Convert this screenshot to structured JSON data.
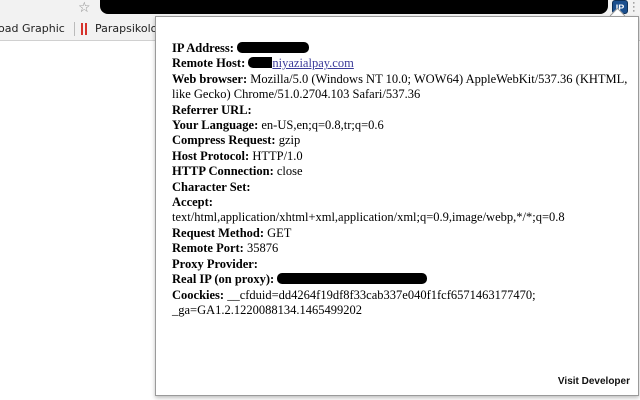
{
  "bookmarks": [
    "oad Graphic G",
    "Parapsikoloji,"
  ],
  "extension": {
    "badge": "IP"
  },
  "fields": [
    {
      "label": "IP Address:",
      "value": ""
    },
    {
      "label": "Remote Host:",
      "value": "niyazialpay.com"
    },
    {
      "label": "Web browser:",
      "value": "Mozilla/5.0 (Windows NT 10.0; WOW64) AppleWebKit/537.36 (KHTML, like Gecko) Chrome/51.0.2704.103 Safari/537.36"
    },
    {
      "label": "Referrer URL:",
      "value": ""
    },
    {
      "label": "Your Language:",
      "value": "en-US,en;q=0.8,tr;q=0.6"
    },
    {
      "label": "Compress Request:",
      "value": "gzip"
    },
    {
      "label": "Host Protocol:",
      "value": "HTTP/1.0"
    },
    {
      "label": "HTTP Connection:",
      "value": "close"
    },
    {
      "label": "Character Set:",
      "value": ""
    },
    {
      "label": "Accept:",
      "value": "text/html,application/xhtml+xml,application/xml;q=0.9,image/webp,*/*;q=0.8"
    },
    {
      "label": "Request Method:",
      "value": "GET"
    },
    {
      "label": "Remote Port:",
      "value": "35876"
    },
    {
      "label": "Proxy Provider:",
      "value": ""
    },
    {
      "label": "Real IP (on proxy):",
      "value": ""
    },
    {
      "label": "Coockies:",
      "value": "__cfduid=dd4264f19df8f33cab337e040f1fcf6571463177470; _ga=GA1.2.1220088134.1465499202"
    }
  ],
  "footer": {
    "visit_label": "Visit Developer"
  },
  "colors": {
    "link": "#3b3b9a",
    "badge": "#1b4f8e"
  }
}
